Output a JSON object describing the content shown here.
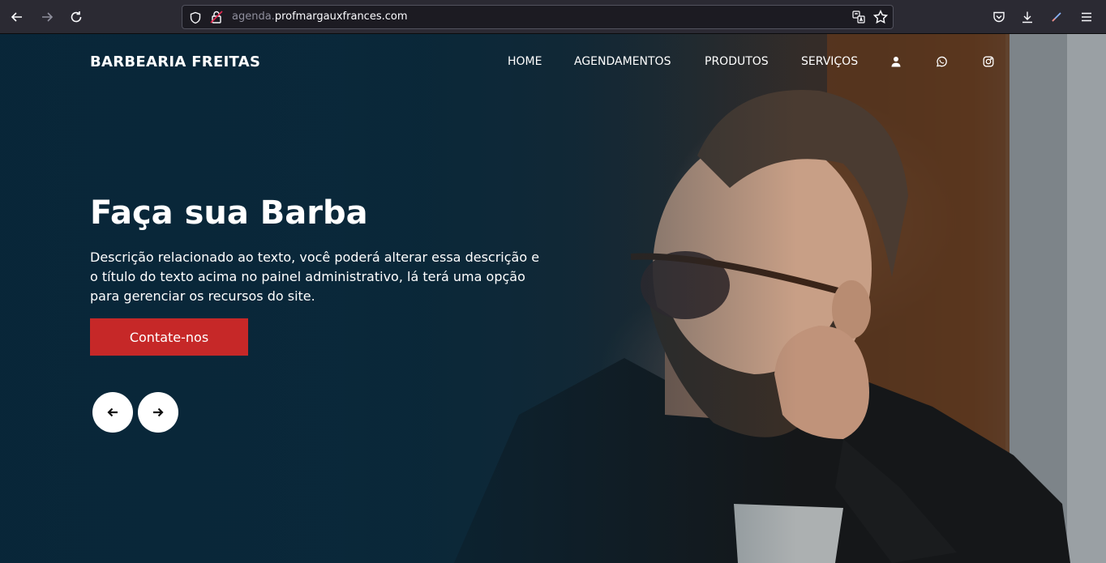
{
  "browser": {
    "url_subdomain": "agenda.",
    "url_domain": "profmargauxfrances.com"
  },
  "site": {
    "brand": "BARBEARIA FREITAS",
    "nav": [
      "HOME",
      "AGENDAMENTOS",
      "PRODUTOS",
      "SERVIÇOS"
    ],
    "nav_icons": [
      "user-icon",
      "whatsapp-icon",
      "instagram-icon"
    ]
  },
  "hero": {
    "title": "Faça sua Barba",
    "description": "Descrição relacionado ao texto, você poderá alterar essa descrição e o título do texto acima no painel administrativo, lá terá uma opção para gerenciar os recursos do site.",
    "cta": "Contate-nos"
  },
  "colors": {
    "cta": "#c62828",
    "overlay": "#082638"
  }
}
